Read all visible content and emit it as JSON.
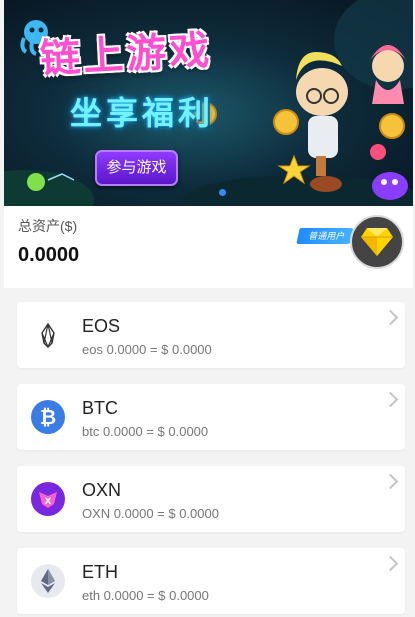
{
  "banner": {
    "title": "链上游戏",
    "subtitle": "坐享福利",
    "button_label": "参与游戏",
    "colors": {
      "title": "#ff4fd0",
      "subtitle": "#6ff4ff",
      "button": "#7a2cf0",
      "active_dot": "#2f8cff"
    }
  },
  "asset": {
    "label": "总资产($)",
    "total": "0.0000",
    "badge": "普通用户",
    "avatar_icon": "diamond-icon"
  },
  "tokens": [
    {
      "symbol": "EOS",
      "balance": "eos 0.0000 = $ 0.0000",
      "icon": "eos-icon"
    },
    {
      "symbol": "BTC",
      "balance": "btc 0.0000 = $ 0.0000",
      "icon": "bitcoin-icon"
    },
    {
      "symbol": "OXN",
      "balance": "OXN 0.0000 = $ 0.0000",
      "icon": "oxn-icon"
    },
    {
      "symbol": "ETH",
      "balance": "eth 0.0000 = $ 0.0000",
      "icon": "ethereum-icon"
    }
  ]
}
